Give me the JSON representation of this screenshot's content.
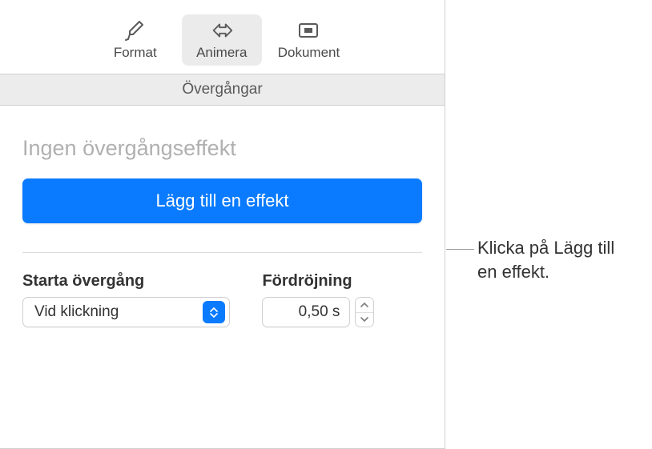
{
  "toolbar": {
    "format": {
      "label": "Format"
    },
    "animate": {
      "label": "Animera"
    },
    "document": {
      "label": "Dokument"
    }
  },
  "section_header": "Övergångar",
  "effect": {
    "title": "Ingen övergångseffekt",
    "add_button": "Lägg till en effekt"
  },
  "controls": {
    "start": {
      "label": "Starta övergång",
      "value": "Vid klickning"
    },
    "delay": {
      "label": "Fördröjning",
      "value": "0,50 s"
    }
  },
  "callout": "Klicka på Lägg till en effekt."
}
